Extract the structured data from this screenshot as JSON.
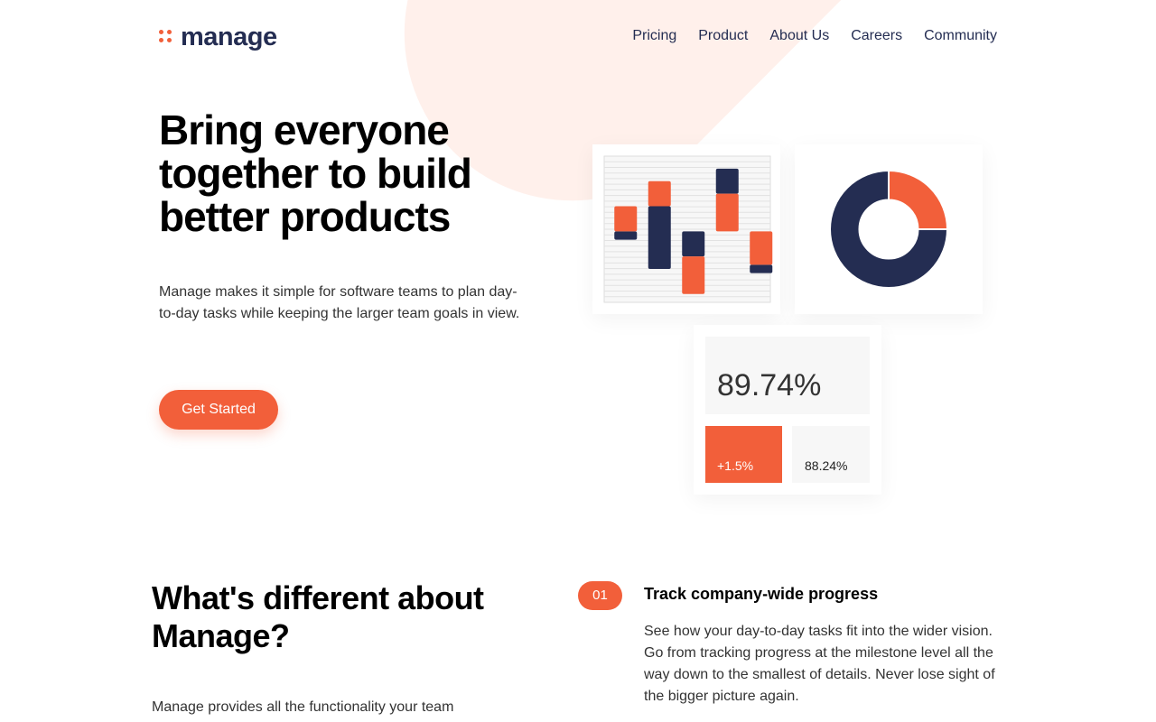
{
  "brand": {
    "name": "manage",
    "accent": "#F25F3A",
    "navy": "#242D52",
    "blob": "#FFF0EB"
  },
  "nav": {
    "items": [
      "Pricing",
      "Product",
      "About Us",
      "Careers",
      "Community"
    ]
  },
  "hero": {
    "title": "Bring everyone together to build better products",
    "description": "Manage makes it simple for software teams to plan day-to-day tasks while keeping the larger team goals in view.",
    "cta": "Get Started"
  },
  "stats": {
    "main": "89.74%",
    "delta": "+1.5%",
    "other": "88.24%"
  },
  "section": {
    "title": "What's different about Manage?",
    "text": "Manage provides all the functionality your team"
  },
  "feature": {
    "number": "01",
    "title": "Track company-wide progress",
    "text": "See how your day-to-day tasks fit into the wider vision. Go from tracking progress at the milestone level all the way down to the smallest of details. Never lose sight of the bigger picture again."
  },
  "chart_data": [
    {
      "type": "bar",
      "bars": [
        {
          "orange": [
            0,
            1.5
          ],
          "navy": [
            -0.5,
            0
          ]
        },
        {
          "orange": [
            1.5,
            3
          ],
          "navy": [
            -2.25,
            1.5
          ]
        },
        {
          "orange": [
            -3.75,
            -1.5
          ],
          "navy": [
            -1.5,
            0
          ]
        },
        {
          "orange": [
            0,
            2.25
          ],
          "navy": [
            2.25,
            3.75
          ]
        },
        {
          "orange": [
            -2,
            0
          ],
          "navy": [
            -2.5,
            -2
          ]
        }
      ],
      "ylim": [
        -4.25,
        4.5
      ],
      "grid": true
    },
    {
      "type": "pie",
      "slices": [
        {
          "color": "navy",
          "value": 75
        },
        {
          "color": "orange",
          "value": 25
        }
      ],
      "hole": 0.5
    }
  ]
}
